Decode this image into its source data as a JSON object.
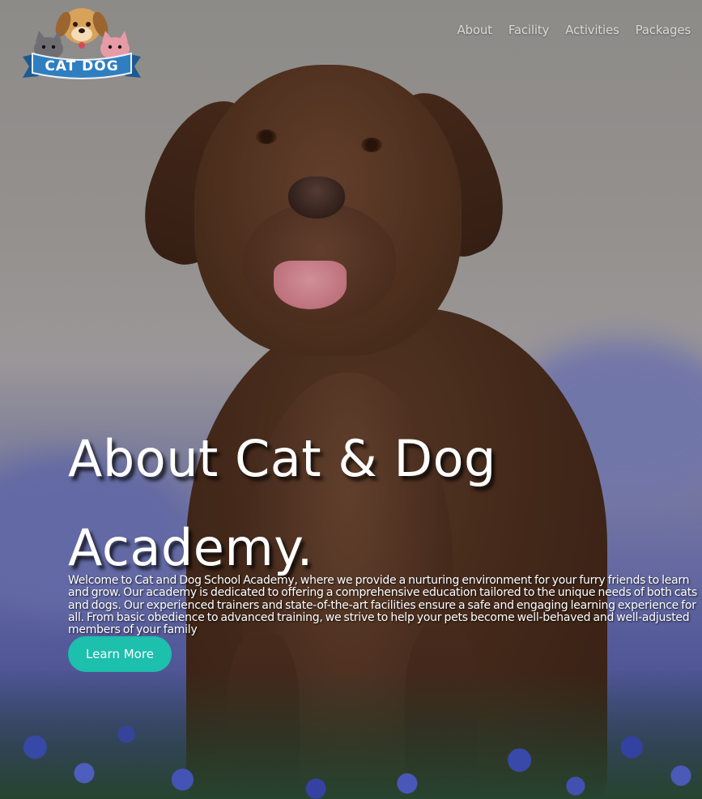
{
  "brand": {
    "logo_text": "CAT DOG",
    "colors": {
      "ribbon": "#2f7fc0",
      "ribbon_dark": "#1d5a92",
      "dog": "#d9a25a",
      "cat_grey": "#6e6e73",
      "cat_pink": "#e79ba6"
    }
  },
  "nav": {
    "items": [
      {
        "label": "About"
      },
      {
        "label": "Facility"
      },
      {
        "label": "Activities"
      },
      {
        "label": "Packages"
      }
    ]
  },
  "hero": {
    "title_line1": "About Cat & Dog",
    "title_line2": "Academy.",
    "description": "Welcome to Cat and Dog School Academy, where we provide a nurturing environment for your furry friends to learn and grow. Our academy is dedicated to offering a comprehensive education tailored to the unique needs of both cats and dogs. Our experienced trainers and state-of-the-art facilities ensure a safe and engaging learning experience for all. From basic obedience to advanced training, we strive to help your pets become well-behaved and well-adjusted members of your family",
    "cta_label": "Learn More",
    "colors": {
      "cta": "#1dbfad",
      "text": "#ffffff"
    }
  }
}
